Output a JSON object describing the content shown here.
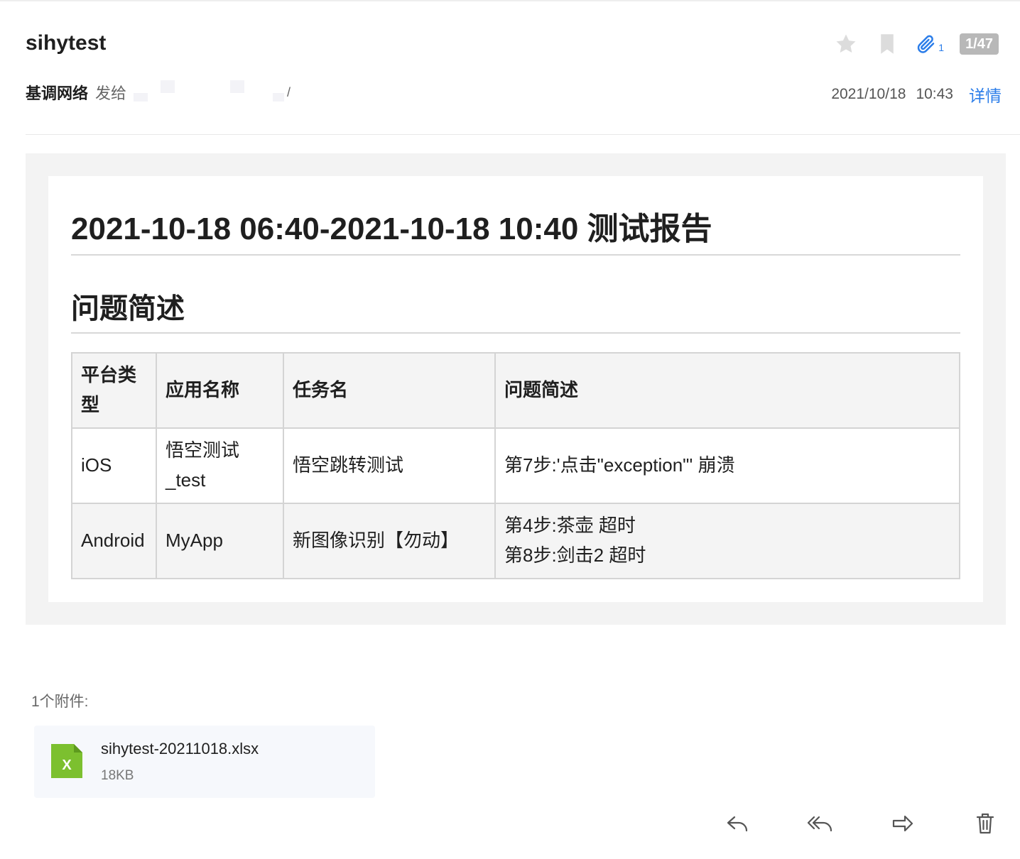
{
  "email": {
    "subject": "sihytest",
    "sender": "基调网络",
    "send_verb": "发给",
    "recipient_suffix": "/",
    "date": "2021/10/18",
    "time": "10:43",
    "details_label": "详情",
    "attachment_count": "1",
    "pager": "1/47"
  },
  "body": {
    "report_title": "2021-10-18 06:40-2021-10-18 10:40 测试报告",
    "section_title": "问题简述",
    "table": {
      "headers": [
        "平台类型",
        "应用名称",
        "任务名",
        "问题简述"
      ],
      "rows": [
        {
          "platform": "iOS",
          "app": "悟空测试_test",
          "task": "悟空跳转测试",
          "issues": [
            "第7步:'点击\"exception\"' 崩溃"
          ]
        },
        {
          "platform": "Android",
          "app": "MyApp",
          "task": "新图像识别【勿动】",
          "issues": [
            "第4步:茶壶 超时",
            "第8步:剑击2 超时"
          ]
        }
      ]
    }
  },
  "attachments": {
    "label": "1个附件:",
    "files": [
      {
        "name": "sihytest-20211018.xlsx",
        "size": "18KB",
        "icon": "excel-file-icon",
        "icon_letter": "X",
        "icon_color": "#7cc02f"
      }
    ]
  },
  "actions": [
    {
      "name": "reply",
      "icon": "reply-icon"
    },
    {
      "name": "reply-all",
      "icon": "reply-all-icon"
    },
    {
      "name": "forward",
      "icon": "forward-icon"
    },
    {
      "name": "delete",
      "icon": "trash-icon"
    }
  ],
  "colors": {
    "accent": "#2b7de9",
    "badge": "#b8b8b8",
    "body_background": "#f3f3f3",
    "excel_green": "#7cc02f"
  }
}
